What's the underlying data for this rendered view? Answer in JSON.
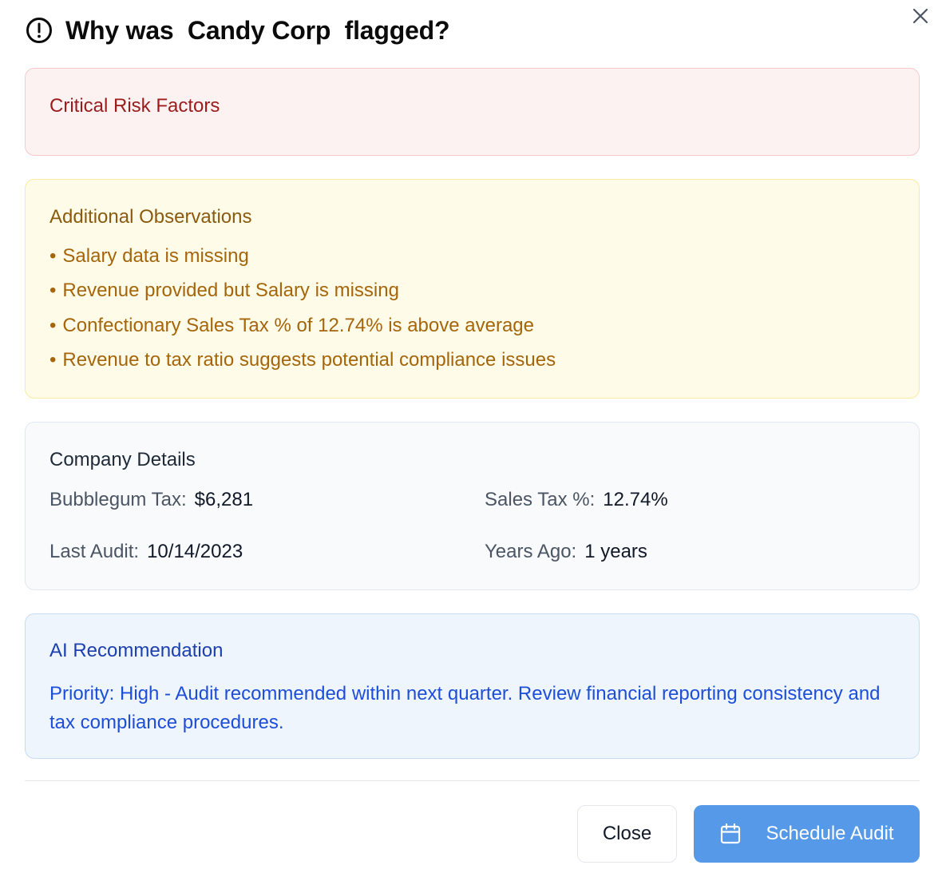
{
  "dialog": {
    "title": "Why was  Candy Corp  flagged?",
    "icons": {
      "alert": "alert-circle-icon",
      "close": "close-icon",
      "calendar": "calendar-icon"
    }
  },
  "critical": {
    "title": "Critical Risk Factors"
  },
  "observations": {
    "title": "Additional Observations",
    "bullet": "•",
    "items": [
      "Salary data is missing",
      "Revenue provided but Salary is missing",
      "Confectionary Sales Tax % of 12.74% is above average",
      "Revenue to tax ratio suggests potential compliance issues"
    ]
  },
  "company": {
    "title": "Company Details",
    "bubblegum_tax": {
      "label": "Bubblegum Tax:",
      "value": "$6,281"
    },
    "sales_tax": {
      "label": "Sales Tax %:",
      "value": "12.74%"
    },
    "last_audit": {
      "label": "Last Audit:",
      "value": "10/14/2023"
    },
    "years_ago": {
      "label": "Years Ago:",
      "value": "1 years"
    }
  },
  "ai": {
    "title": "AI Recommendation",
    "text": "Priority: High - Audit recommended within next quarter. Review financial reporting consistency and tax compliance procedures."
  },
  "footer": {
    "close_label": "Close",
    "schedule_label": "Schedule Audit"
  },
  "colors": {
    "critical_bg": "#fdf2f2",
    "observation_bg": "#fefce8",
    "company_bg": "#f8fafc",
    "ai_bg": "#eef5fd",
    "primary_button": "#5599e8"
  }
}
